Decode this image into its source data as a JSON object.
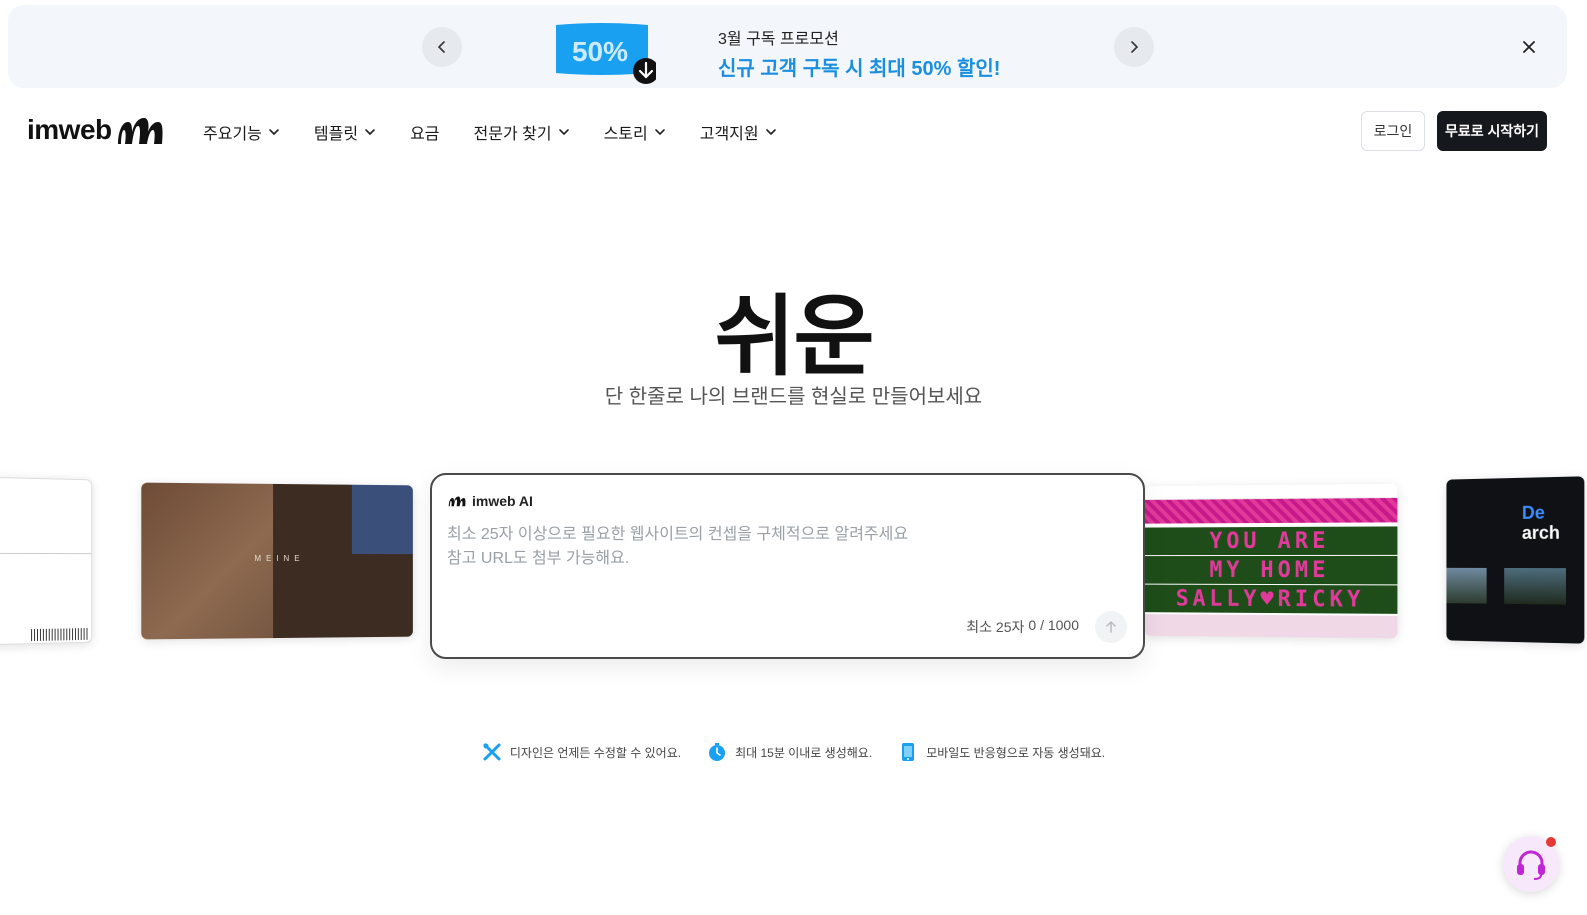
{
  "promo": {
    "badge_text": "50%",
    "eyebrow": "3월 구독 프로모션",
    "headline": "신규 고객 구독 시 최대 50% 할인!"
  },
  "nav": {
    "logo_text": "imweb",
    "items": [
      {
        "label": "주요기능",
        "has_dropdown": true
      },
      {
        "label": "템플릿",
        "has_dropdown": true
      },
      {
        "label": "요금",
        "has_dropdown": false
      },
      {
        "label": "전문가 찾기",
        "has_dropdown": true
      },
      {
        "label": "스토리",
        "has_dropdown": true
      },
      {
        "label": "고객지원",
        "has_dropdown": true
      }
    ],
    "login_label": "로그인",
    "start_label": "무료로 시작하기"
  },
  "hero": {
    "title": "쉬운",
    "subtitle": "단 한줄로 나의 브랜드를 현실로 만들어보세요"
  },
  "carousel": {
    "card2_label": "MEINE",
    "card3_rows": [
      "YOU ARE",
      "MY HOME",
      "SALLY♥RICKY"
    ],
    "card4_title_accent": "De",
    "card4_title": "arch"
  },
  "ai": {
    "label": "imweb AI",
    "placeholder": "최소 25자 이상으로 필요한 웹사이트의 컨셉을 구체적으로 알려주세요\n참고 URL도 첨부 가능해요.",
    "value": "",
    "min_label": "최소 25자",
    "count_label": "0 / 1000"
  },
  "features": [
    {
      "icon": "tools-icon",
      "text": "디자인은 언제든 수정할 수 있어요."
    },
    {
      "icon": "stopwatch-icon",
      "text": "최대 15분 이내로 생성해요."
    },
    {
      "icon": "mobile-icon",
      "text": "모바일도 반응형으로 자동 생성돼요."
    }
  ],
  "colors": {
    "accent_blue": "#1a8fe0",
    "dark_button": "#15181d",
    "support_bg": "#f7e9fb",
    "support_icon": "#c026d3"
  }
}
